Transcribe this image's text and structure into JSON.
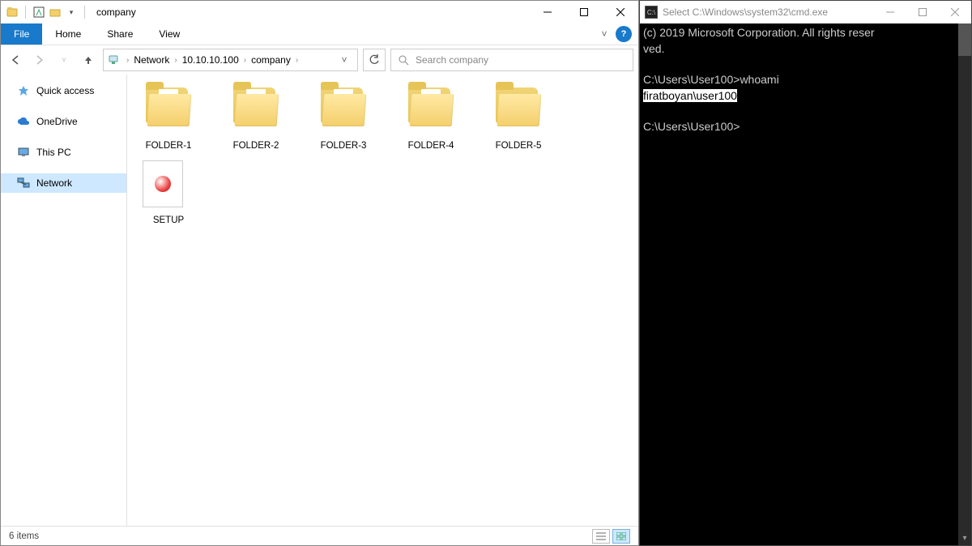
{
  "explorer": {
    "title": "company",
    "tabs": {
      "file": "File",
      "home": "Home",
      "share": "Share",
      "view": "View"
    },
    "breadcrumb": [
      "Network",
      "10.10.10.100",
      "company"
    ],
    "search_placeholder": "Search company",
    "sidebar": {
      "quick_access": "Quick access",
      "onedrive": "OneDrive",
      "this_pc": "This PC",
      "network": "Network"
    },
    "items": [
      {
        "name": "FOLDER-1",
        "type": "folder-docs"
      },
      {
        "name": "FOLDER-2",
        "type": "folder-docs"
      },
      {
        "name": "FOLDER-3",
        "type": "folder-docs"
      },
      {
        "name": "FOLDER-4",
        "type": "folder-docs"
      },
      {
        "name": "FOLDER-5",
        "type": "folder-empty"
      },
      {
        "name": "SETUP",
        "type": "setup"
      }
    ],
    "status": "6 items"
  },
  "cmd": {
    "title": "Select C:\\Windows\\system32\\cmd.exe",
    "line1": "(c) 2019 Microsoft Corporation. All rights reser",
    "line2": "ved.",
    "prompt1": "C:\\Users\\User100>",
    "command1": "whoami",
    "output1": "firatboyan\\user100",
    "prompt2": "C:\\Users\\User100>"
  }
}
